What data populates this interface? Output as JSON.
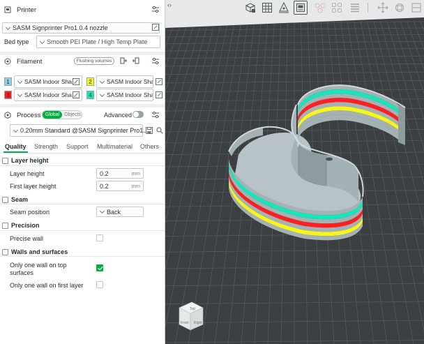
{
  "printer": {
    "section_title": "Printer",
    "name": "SASM Signprinter Pro1 0.4 nozzle",
    "bed_type_label": "Bed type",
    "bed_type_value": "Smooth PEI Plate / High Temp Plate"
  },
  "filament": {
    "section_title": "Filament",
    "flushing_label": "Flushing volumes",
    "items": [
      {
        "num": "1",
        "color": "#8fd3e0",
        "name": "SASM Indoor Sha..."
      },
      {
        "num": "2",
        "color": "#f6f61e",
        "name": "SASM Indoor Sha..."
      },
      {
        "num": "3",
        "color": "#ff1f1f",
        "name": "SASM Indoor Sha..."
      },
      {
        "num": "4",
        "color": "#12e8b9",
        "name": "SASM Indoor Sha..."
      }
    ]
  },
  "process": {
    "section_title": "Process",
    "toggle_global": "Global",
    "toggle_objects": "Objects",
    "advanced_label": "Advanced",
    "preset": "0.20mm Standard @SASM Signprinter Pro1...",
    "tabs": [
      "Quality",
      "Strength",
      "Support",
      "Multimaterial",
      "Others"
    ]
  },
  "settings": {
    "layer_height_group": "Layer height",
    "layer_height_label": "Layer height",
    "layer_height_value": "0.2",
    "layer_height_unit": "mm",
    "first_layer_label": "First layer height",
    "first_layer_value": "0.2",
    "first_layer_unit": "mm",
    "seam_group": "Seam",
    "seam_position_label": "Seam position",
    "seam_position_value": "Back",
    "precision_group": "Precision",
    "precise_wall_label": "Precise wall",
    "precise_wall_checked": false,
    "walls_group": "Walls and surfaces",
    "one_wall_top_label_1": "Only one wall on top",
    "one_wall_top_label_2": "surfaces",
    "one_wall_top_checked": true,
    "one_wall_first_label": "Only one wall on first layer",
    "one_wall_first_checked": false
  },
  "viewcube": {
    "top": "Top",
    "front": "Front",
    "right": "Right"
  },
  "colors": {
    "accent": "#00ae42",
    "bed": "#3b3f42",
    "model_base": "#a5b2b5"
  }
}
